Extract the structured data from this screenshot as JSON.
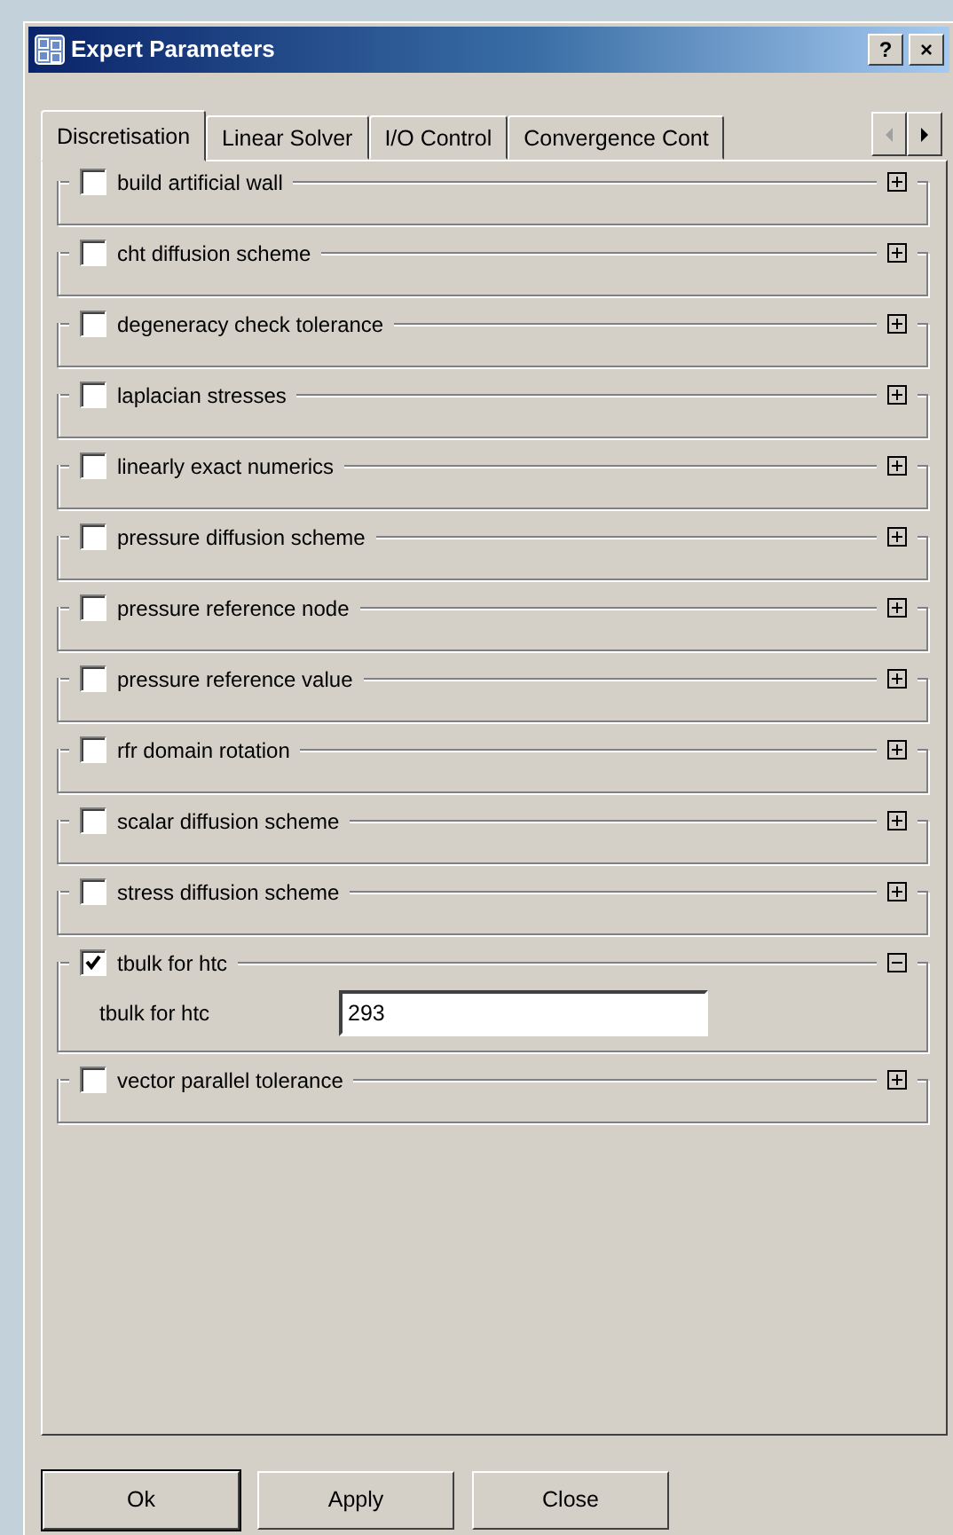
{
  "window": {
    "title": "Expert Parameters",
    "help_button": "?",
    "close_button": "×"
  },
  "tabs": [
    {
      "label": "Discretisation",
      "selected": true
    },
    {
      "label": "Linear Solver",
      "selected": false
    },
    {
      "label": "I/O Control",
      "selected": false
    },
    {
      "label": "Convergence Cont",
      "selected": false
    }
  ],
  "groups": [
    {
      "label": "build artificial wall",
      "checked": false,
      "expanded": false
    },
    {
      "label": "cht diffusion scheme",
      "checked": false,
      "expanded": false
    },
    {
      "label": "degeneracy check tolerance",
      "checked": false,
      "expanded": false
    },
    {
      "label": "laplacian stresses",
      "checked": false,
      "expanded": false
    },
    {
      "label": "linearly exact numerics",
      "checked": false,
      "expanded": false
    },
    {
      "label": "pressure diffusion scheme",
      "checked": false,
      "expanded": false
    },
    {
      "label": "pressure reference node",
      "checked": false,
      "expanded": false
    },
    {
      "label": "pressure reference value",
      "checked": false,
      "expanded": false
    },
    {
      "label": "rfr domain rotation",
      "checked": false,
      "expanded": false
    },
    {
      "label": "scalar diffusion scheme",
      "checked": false,
      "expanded": false
    },
    {
      "label": "stress diffusion scheme",
      "checked": false,
      "expanded": false
    },
    {
      "label": "tbulk for htc",
      "checked": true,
      "expanded": true,
      "fields": [
        {
          "label": "tbulk for htc",
          "value": "293"
        }
      ]
    },
    {
      "label": "vector parallel tolerance",
      "checked": false,
      "expanded": false
    }
  ],
  "buttons": [
    "Ok",
    "Apply",
    "Close"
  ]
}
